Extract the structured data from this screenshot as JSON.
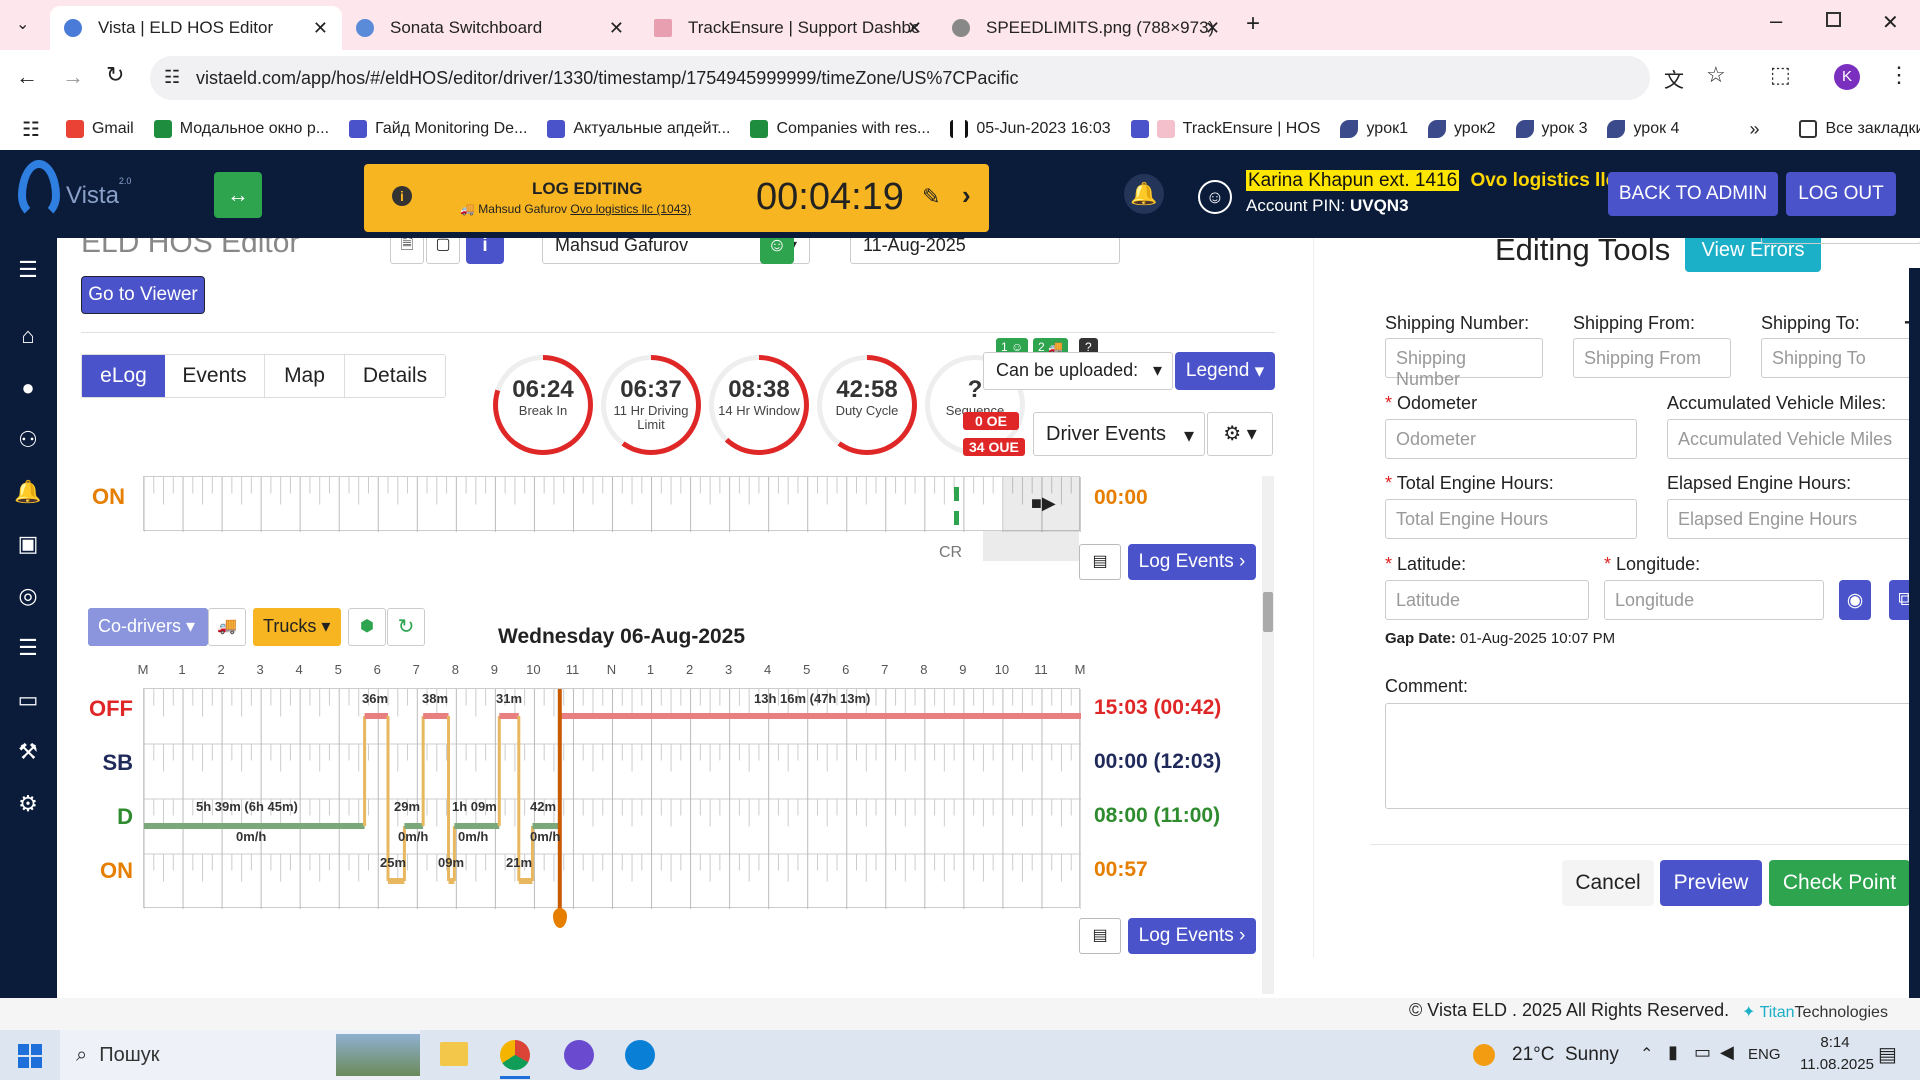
{
  "browser": {
    "tabs": [
      {
        "title": "Vista | ELD HOS Editor",
        "active": true
      },
      {
        "title": "Sonata Switchboard",
        "active": false
      },
      {
        "title": "TrackEnsure | Support Dashboa",
        "active": false
      },
      {
        "title": "SPEEDLIMITS.png (788×973)",
        "active": false
      }
    ],
    "url": "vistaeld.com/app/hos/#/eldHOS/editor/driver/1330/timestamp/1754945999999/timeZone/US%7CPacific",
    "bookmarks": [
      "Gmail",
      "Модальное окно р...",
      "Гайд Monitoring De...",
      "Актуальные апдейт...",
      "Companies with res...",
      "05-Jun-2023 16:03",
      "TrackEnsure | HOS",
      "урок1",
      "урок2",
      "урок 3",
      "урок 4"
    ],
    "all_bookmarks": "Все закладки",
    "profile_initial": "K"
  },
  "header": {
    "logo_text": "Vista",
    "logo_version": "2.0",
    "log_editing_title": "LOG EDITING",
    "log_editing_driver": "Mahsud Gafurov",
    "log_editing_company": "Ovo logistics llc (1043)",
    "timer": "00:04:19",
    "user_name": "Karina Khapun ext. 1416",
    "company": "Ovo logistics llc",
    "account_pin_label": "Account PIN:",
    "account_pin": "UVQN3",
    "back_to_admin": "BACK TO ADMIN",
    "log_out": "LOG OUT"
  },
  "editor": {
    "title": "ELD HOS Editor",
    "driver_select": "Mahsud Gafurov",
    "date": "11-Aug-2025",
    "go_to_viewer": "Go to Viewer",
    "tabs": [
      "eLog",
      "Events",
      "Map",
      "Details"
    ],
    "clocks": [
      {
        "value": "06:24",
        "label": "Break In",
        "fraction": 0.8
      },
      {
        "value": "06:37",
        "label": "11 Hr Driving Limit",
        "fraction": 0.6
      },
      {
        "value": "08:38",
        "label": "14 Hr Window",
        "fraction": 0.62
      },
      {
        "value": "42:58",
        "label": "Duty Cycle",
        "fraction": 0.6
      },
      {
        "value": "?",
        "label": "Sequence",
        "fraction": 0
      }
    ],
    "badges": {
      "b1": "1",
      "b2": "2",
      "b3": "?",
      "oue0": "0 OE",
      "oue34": "34 OUE"
    },
    "can_be_uploaded": "Can be uploaded:",
    "legend": "Legend",
    "driver_events": "Driver Events",
    "top_strip": {
      "status": "ON",
      "total": "00:00",
      "cr_label": "CR"
    },
    "log_events": "Log Events",
    "co_drivers": "Co-drivers",
    "trucks": "Trucks",
    "day_title": "Wednesday 06-Aug-2025",
    "hours": [
      "M",
      "1",
      "2",
      "3",
      "4",
      "5",
      "6",
      "7",
      "8",
      "9",
      "10",
      "11",
      "N",
      "1",
      "2",
      "3",
      "4",
      "5",
      "6",
      "7",
      "8",
      "9",
      "10",
      "11",
      "M"
    ],
    "statuses": [
      {
        "name": "OFF",
        "total": "15:03 (00:42)",
        "color": "#e02727"
      },
      {
        "name": "SB",
        "total": "00:00 (12:03)",
        "color": "#1f2a5a"
      },
      {
        "name": "D",
        "total": "08:00 (11:00)",
        "color": "#2e8b2e"
      },
      {
        "name": "ON",
        "total": "00:57",
        "color": "#e67e00"
      }
    ],
    "durations": {
      "off1": "36m",
      "off2": "38m",
      "off3": "31m",
      "off4": "13h 16m (47h 13m)",
      "d1": "5h 39m (6h 45m)",
      "d2": "29m",
      "d3": "1h 09m",
      "d4": "42m",
      "sp1": "0m/h",
      "sp2": "0m/h",
      "sp3": "0m/h",
      "sp4": "0m/h",
      "on1": "25m",
      "on2": "09m",
      "on3": "21m"
    }
  },
  "editing_tools": {
    "title": "Editing Tools",
    "view_errors": "View Errors",
    "shipping_number_label": "Shipping Number:",
    "shipping_number_ph": "Shipping Number",
    "shipping_from_label": "Shipping From:",
    "shipping_from_ph": "Shipping From",
    "shipping_to_label": "Shipping To:",
    "shipping_to_ph": "Shipping To",
    "odometer_label": "Odometer",
    "odometer_ph": "Odometer",
    "acc_miles_label": "Accumulated Vehicle Miles:",
    "acc_miles_ph": "Accumulated Vehicle Miles",
    "total_engine_label": "Total Engine Hours:",
    "total_engine_ph": "Total Engine Hours",
    "elapsed_engine_label": "Elapsed Engine Hours:",
    "elapsed_engine_ph": "Elapsed Engine Hours",
    "latitude_label": "Latitude:",
    "latitude_ph": "Latitude",
    "longitude_label": "Longitude:",
    "longitude_ph": "Longitude",
    "gap_date_label": "Gap Date:",
    "gap_date": "01-Aug-2025 10:07 PM",
    "comment_label": "Comment:",
    "cancel": "Cancel",
    "preview": "Preview",
    "check_point": "Check Point"
  },
  "footer": {
    "copyright": "© Vista ELD . 2025 All Rights Reserved.",
    "titan": "Titan",
    "technologies": "Technologies"
  },
  "taskbar": {
    "search": "Пошук",
    "weather": "21°C  Sunny",
    "lang": "ENG",
    "time": "8:14",
    "date": "11.08.2025"
  }
}
